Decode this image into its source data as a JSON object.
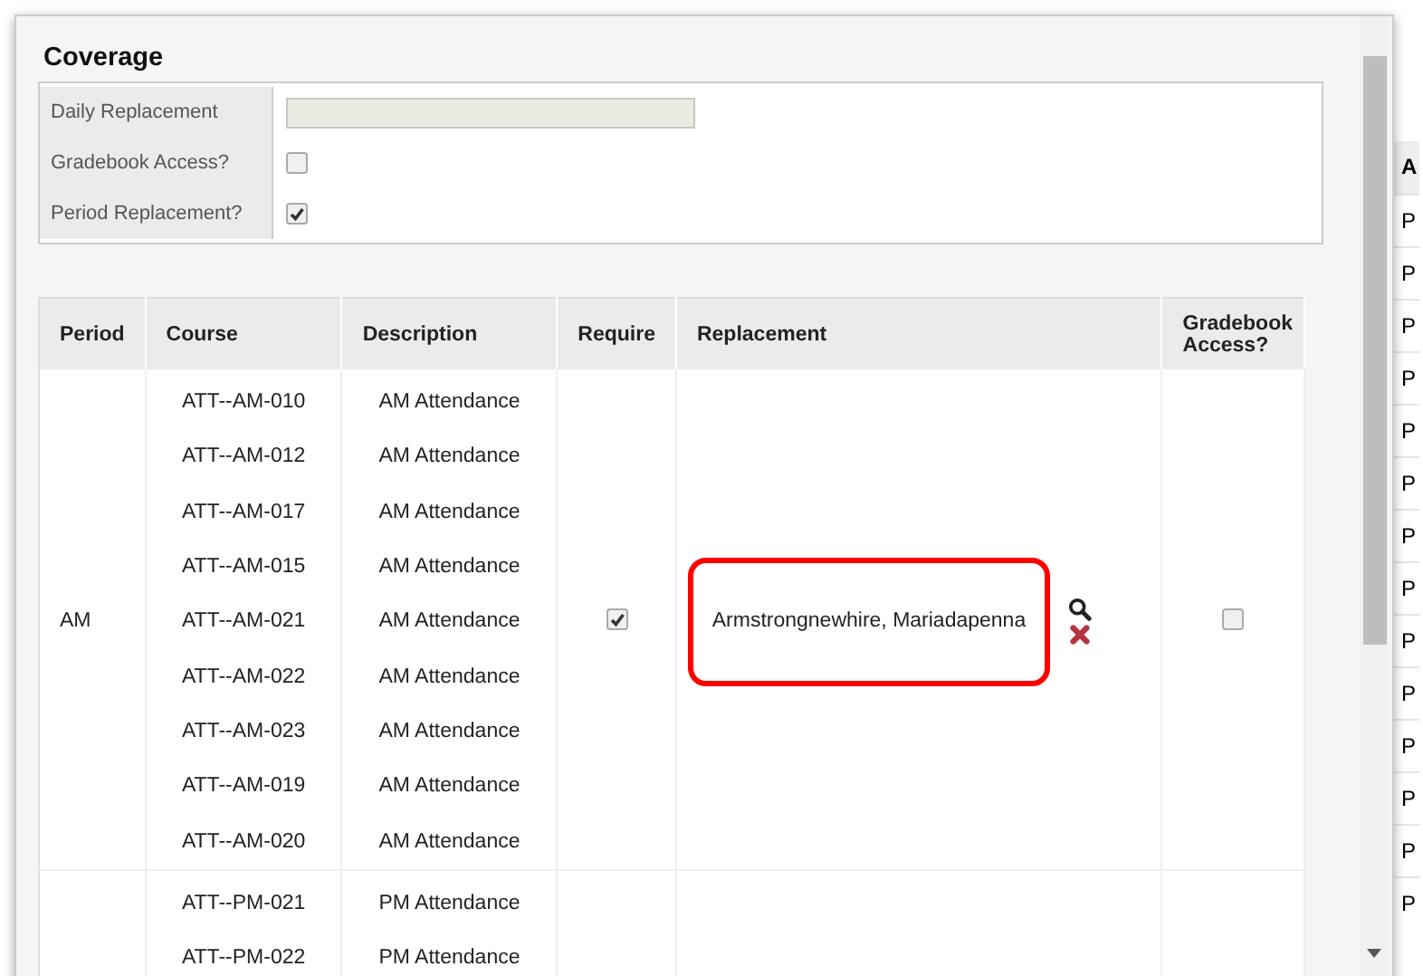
{
  "background_table": {
    "header": "A",
    "rows": [
      "P",
      "P",
      "P",
      "P",
      "P",
      "P",
      "P",
      "P",
      "P",
      "P",
      "P",
      "P",
      "P",
      "P"
    ]
  },
  "dialog": {
    "title": "Coverage",
    "fields": [
      {
        "kind": "text",
        "label": "Daily Replacement"
      },
      {
        "kind": "checkbox",
        "label": "Gradebook Access?",
        "checked": false
      },
      {
        "kind": "checkbox",
        "label": "Period Replacement?",
        "checked": true
      }
    ],
    "table": {
      "columns": [
        "Period",
        "Course",
        "Description",
        "Require",
        "Replacement",
        "Gradebook Access?"
      ],
      "groups": [
        {
          "period": "AM",
          "require": true,
          "replacement": "Armstrongnewhire, Mariadapenna",
          "highlighted": true,
          "gradebook_access": false,
          "courses": [
            {
              "course": "ATT--AM-010",
              "description": "AM Attendance"
            },
            {
              "course": "ATT--AM-012",
              "description": "AM Attendance"
            },
            {
              "course": "ATT--AM-017",
              "description": "AM Attendance"
            },
            {
              "course": "ATT--AM-015",
              "description": "AM Attendance"
            },
            {
              "course": "ATT--AM-021",
              "description": "AM Attendance"
            },
            {
              "course": "ATT--AM-022",
              "description": "AM Attendance"
            },
            {
              "course": "ATT--AM-023",
              "description": "AM Attendance"
            },
            {
              "course": "ATT--AM-019",
              "description": "AM Attendance"
            },
            {
              "course": "ATT--AM-020",
              "description": "AM Attendance"
            }
          ]
        },
        {
          "courses": [
            {
              "course": "ATT--PM-021",
              "description": "PM Attendance"
            },
            {
              "course": "ATT--PM-022",
              "description": "PM Attendance"
            }
          ]
        }
      ]
    }
  }
}
